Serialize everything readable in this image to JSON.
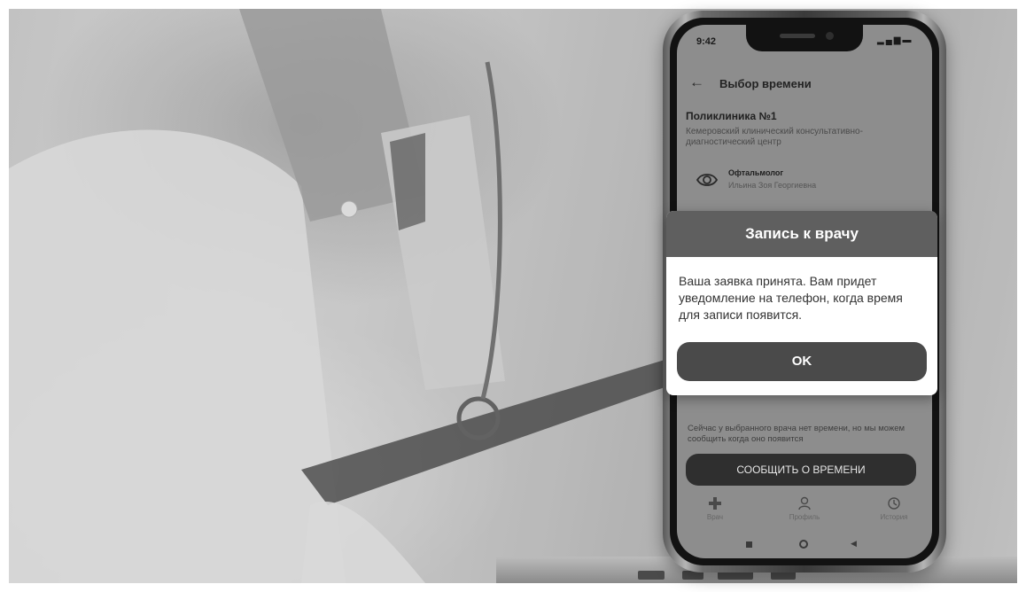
{
  "phone": {
    "status_time": "9:42",
    "appbar": {
      "title": "Выбор времени"
    },
    "clinic": {
      "name": "Поликлиника №1",
      "description": "Кемеровский клинический консультативно-диагностический центр"
    },
    "doctor": {
      "specialty": "Офтальмолог",
      "name": "Ильина Зоя Георгиевна"
    },
    "notice": "Сейчас у выбранного врача нет времени, но мы можем сообщить когда оно появится",
    "notify_button": "СООБЩИТЬ О ВРЕМЕНИ",
    "tabs": [
      {
        "label": "Врач",
        "icon": "plus-icon"
      },
      {
        "label": "Профиль",
        "icon": "person-icon"
      },
      {
        "label": "История",
        "icon": "history-icon"
      }
    ]
  },
  "dialog": {
    "title": "Запись к врачу",
    "message": "Ваша заявка принята. Вам придет уведомление на телефон, когда время для записи появится.",
    "ok_button": "OK"
  },
  "colors": {
    "dialog_header": "#5f5f5f",
    "ok_button": "#4a4a4a",
    "notify_button": "#2f2f2f"
  }
}
